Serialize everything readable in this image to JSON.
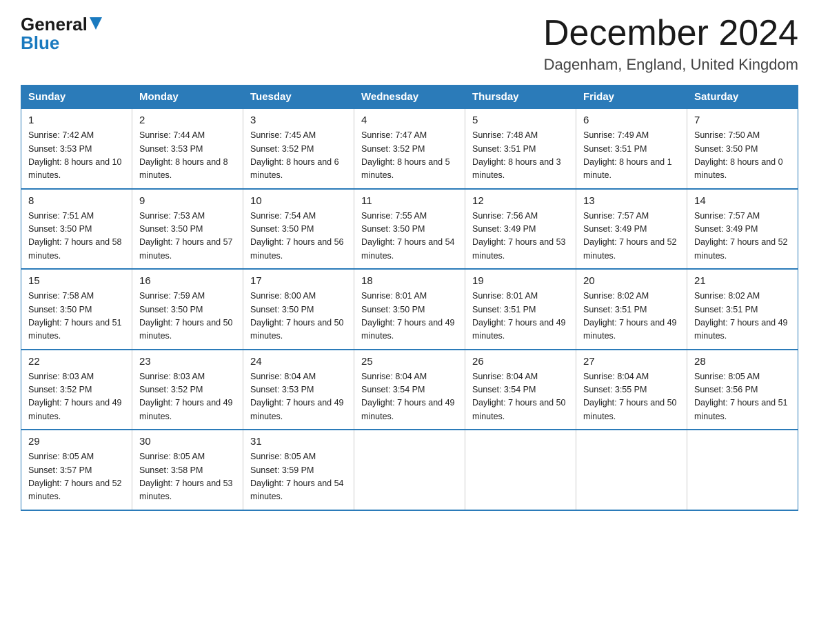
{
  "header": {
    "logo_line1": "General",
    "logo_triangle": "▶",
    "logo_line2": "Blue",
    "month_title": "December 2024",
    "location": "Dagenham, England, United Kingdom"
  },
  "days_of_week": [
    "Sunday",
    "Monday",
    "Tuesday",
    "Wednesday",
    "Thursday",
    "Friday",
    "Saturday"
  ],
  "weeks": [
    [
      {
        "day": "1",
        "sunrise": "7:42 AM",
        "sunset": "3:53 PM",
        "daylight": "8 hours and 10 minutes."
      },
      {
        "day": "2",
        "sunrise": "7:44 AM",
        "sunset": "3:53 PM",
        "daylight": "8 hours and 8 minutes."
      },
      {
        "day": "3",
        "sunrise": "7:45 AM",
        "sunset": "3:52 PM",
        "daylight": "8 hours and 6 minutes."
      },
      {
        "day": "4",
        "sunrise": "7:47 AM",
        "sunset": "3:52 PM",
        "daylight": "8 hours and 5 minutes."
      },
      {
        "day": "5",
        "sunrise": "7:48 AM",
        "sunset": "3:51 PM",
        "daylight": "8 hours and 3 minutes."
      },
      {
        "day": "6",
        "sunrise": "7:49 AM",
        "sunset": "3:51 PM",
        "daylight": "8 hours and 1 minute."
      },
      {
        "day": "7",
        "sunrise": "7:50 AM",
        "sunset": "3:50 PM",
        "daylight": "8 hours and 0 minutes."
      }
    ],
    [
      {
        "day": "8",
        "sunrise": "7:51 AM",
        "sunset": "3:50 PM",
        "daylight": "7 hours and 58 minutes."
      },
      {
        "day": "9",
        "sunrise": "7:53 AM",
        "sunset": "3:50 PM",
        "daylight": "7 hours and 57 minutes."
      },
      {
        "day": "10",
        "sunrise": "7:54 AM",
        "sunset": "3:50 PM",
        "daylight": "7 hours and 56 minutes."
      },
      {
        "day": "11",
        "sunrise": "7:55 AM",
        "sunset": "3:50 PM",
        "daylight": "7 hours and 54 minutes."
      },
      {
        "day": "12",
        "sunrise": "7:56 AM",
        "sunset": "3:49 PM",
        "daylight": "7 hours and 53 minutes."
      },
      {
        "day": "13",
        "sunrise": "7:57 AM",
        "sunset": "3:49 PM",
        "daylight": "7 hours and 52 minutes."
      },
      {
        "day": "14",
        "sunrise": "7:57 AM",
        "sunset": "3:49 PM",
        "daylight": "7 hours and 52 minutes."
      }
    ],
    [
      {
        "day": "15",
        "sunrise": "7:58 AM",
        "sunset": "3:50 PM",
        "daylight": "7 hours and 51 minutes."
      },
      {
        "day": "16",
        "sunrise": "7:59 AM",
        "sunset": "3:50 PM",
        "daylight": "7 hours and 50 minutes."
      },
      {
        "day": "17",
        "sunrise": "8:00 AM",
        "sunset": "3:50 PM",
        "daylight": "7 hours and 50 minutes."
      },
      {
        "day": "18",
        "sunrise": "8:01 AM",
        "sunset": "3:50 PM",
        "daylight": "7 hours and 49 minutes."
      },
      {
        "day": "19",
        "sunrise": "8:01 AM",
        "sunset": "3:51 PM",
        "daylight": "7 hours and 49 minutes."
      },
      {
        "day": "20",
        "sunrise": "8:02 AM",
        "sunset": "3:51 PM",
        "daylight": "7 hours and 49 minutes."
      },
      {
        "day": "21",
        "sunrise": "8:02 AM",
        "sunset": "3:51 PM",
        "daylight": "7 hours and 49 minutes."
      }
    ],
    [
      {
        "day": "22",
        "sunrise": "8:03 AM",
        "sunset": "3:52 PM",
        "daylight": "7 hours and 49 minutes."
      },
      {
        "day": "23",
        "sunrise": "8:03 AM",
        "sunset": "3:52 PM",
        "daylight": "7 hours and 49 minutes."
      },
      {
        "day": "24",
        "sunrise": "8:04 AM",
        "sunset": "3:53 PM",
        "daylight": "7 hours and 49 minutes."
      },
      {
        "day": "25",
        "sunrise": "8:04 AM",
        "sunset": "3:54 PM",
        "daylight": "7 hours and 49 minutes."
      },
      {
        "day": "26",
        "sunrise": "8:04 AM",
        "sunset": "3:54 PM",
        "daylight": "7 hours and 50 minutes."
      },
      {
        "day": "27",
        "sunrise": "8:04 AM",
        "sunset": "3:55 PM",
        "daylight": "7 hours and 50 minutes."
      },
      {
        "day": "28",
        "sunrise": "8:05 AM",
        "sunset": "3:56 PM",
        "daylight": "7 hours and 51 minutes."
      }
    ],
    [
      {
        "day": "29",
        "sunrise": "8:05 AM",
        "sunset": "3:57 PM",
        "daylight": "7 hours and 52 minutes."
      },
      {
        "day": "30",
        "sunrise": "8:05 AM",
        "sunset": "3:58 PM",
        "daylight": "7 hours and 53 minutes."
      },
      {
        "day": "31",
        "sunrise": "8:05 AM",
        "sunset": "3:59 PM",
        "daylight": "7 hours and 54 minutes."
      },
      null,
      null,
      null,
      null
    ]
  ]
}
